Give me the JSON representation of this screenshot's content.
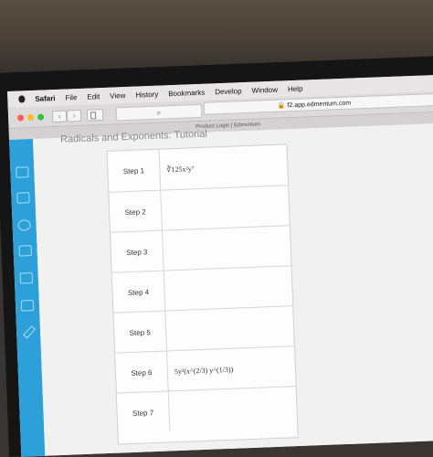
{
  "menubar": {
    "app": "Safari",
    "items": [
      "File",
      "Edit",
      "View",
      "History",
      "Bookmarks",
      "Develop",
      "Window",
      "Help"
    ]
  },
  "toolbar": {
    "address": "f2.app.edmentum.com",
    "tab_title": "Product Login | Edmentum"
  },
  "page": {
    "title": "Radicals and Exponents: Tutorial"
  },
  "steps": [
    {
      "label": "Step 1",
      "expr": "∛125x²y⁷"
    },
    {
      "label": "Step 2",
      "expr": ""
    },
    {
      "label": "Step 3",
      "expr": ""
    },
    {
      "label": "Step 4",
      "expr": ""
    },
    {
      "label": "Step 5",
      "expr": ""
    },
    {
      "label": "Step 6",
      "expr": "5y²(x^(2/3) y^(1/3))"
    },
    {
      "label": "Step 7",
      "expr": ""
    }
  ],
  "colors": {
    "rail": "#2da0da",
    "close": "#fc5f57",
    "min": "#fdbc2e",
    "max": "#28c840"
  }
}
